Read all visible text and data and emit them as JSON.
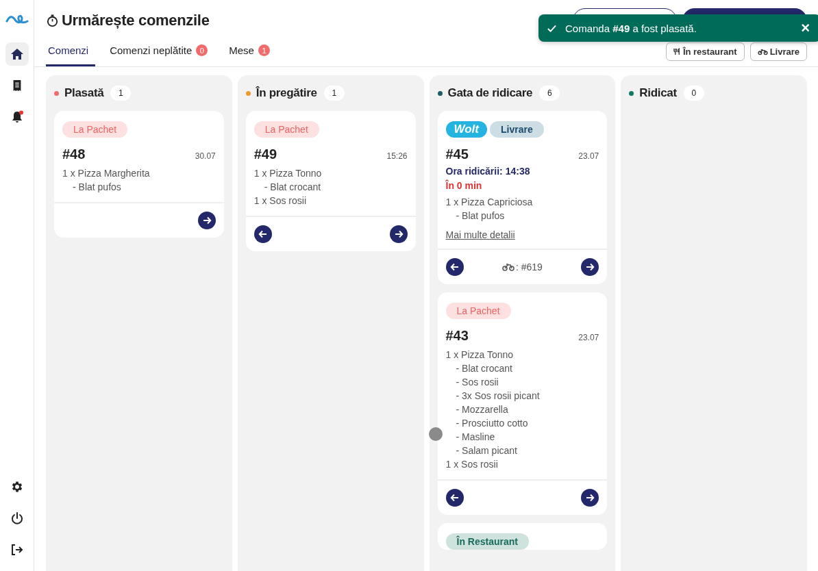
{
  "sidebar": {
    "items": [
      {
        "kind": "home",
        "selected": true
      },
      {
        "kind": "receipt",
        "selected": false
      },
      {
        "kind": "bell",
        "selected": false,
        "badge": true
      }
    ],
    "bottom_items": [
      {
        "kind": "settings"
      },
      {
        "kind": "power"
      },
      {
        "kind": "logout"
      }
    ]
  },
  "header": {
    "title": "Urmărește comenzile"
  },
  "tabs": [
    {
      "label": "Comenzi",
      "selected": true
    },
    {
      "label": "Comenzi neplătite",
      "count": "0",
      "selected": false
    },
    {
      "label": "Mese",
      "count": "1",
      "selected": false
    }
  ],
  "filters": [
    {
      "kind": "restaurant",
      "label": "În restaurant"
    },
    {
      "kind": "delivery",
      "label": "Livrare"
    }
  ],
  "toast": {
    "text": "Comanda **#49** a fost plasată.",
    "close": "×"
  },
  "columns": [
    {
      "title": "Plasată",
      "count": "1",
      "color": "#f26b6b",
      "cards": [
        {
          "tags": [
            {
              "kind": "pachet",
              "label": "La Pachet"
            }
          ],
          "number": "#48",
          "time": "30.07",
          "items": [
            {
              "text": "1 x Pizza Margherita",
              "children": [
                {
                  "text": "- Blat pufos"
                }
              ]
            }
          ],
          "back": false,
          "forward": true
        }
      ]
    },
    {
      "title": "În pregătire",
      "count": "1",
      "color": "#ef9a2d",
      "cards": [
        {
          "tags": [
            {
              "kind": "pachet",
              "label": "La Pachet"
            }
          ],
          "number": "#49",
          "time": "15:26",
          "items": [
            {
              "text": "1 x Pizza Tonno",
              "children": [
                {
                  "text": "- Blat crocant"
                }
              ]
            },
            {
              "text": "1 x Sos rosii"
            }
          ],
          "back": true,
          "forward": true
        }
      ]
    },
    {
      "title": "Gata de ridicare",
      "count": "6",
      "color": "#1b5e66",
      "cards": [
        {
          "tags": [
            {
              "kind": "wolt",
              "label": "Wolt"
            },
            {
              "kind": "livrare",
              "label": "Livrare"
            }
          ],
          "number": "#45",
          "time": "23.07",
          "pickup": "Ora ridicării: 14:38",
          "due": "În 0 min",
          "items": [
            {
              "text": "1 x Pizza Capriciosa",
              "children": [
                {
                  "text": "- Blat pufos"
                }
              ]
            }
          ],
          "link": "Mai multe detalii",
          "courier": ": #619",
          "back": true,
          "forward": true
        },
        {
          "tags": [
            {
              "kind": "pachet",
              "label": "La Pachet"
            }
          ],
          "number": "#43",
          "time": "23.07",
          "items": [
            {
              "text": "1 x Pizza Tonno",
              "children": [
                {
                  "text": "- Blat crocant"
                },
                {
                  "text": "- Sos rosii"
                },
                {
                  "text": "- 3x Sos rosii picant"
                },
                {
                  "text": "- Mozzarella"
                },
                {
                  "text": "- Prosciutto cotto"
                },
                {
                  "text": "- Masline"
                },
                {
                  "text": "- Salam picant"
                }
              ]
            },
            {
              "text": "1 x Sos rosii"
            }
          ],
          "back": true,
          "forward": true
        },
        {
          "tags": [
            {
              "kind": "restaurant",
              "label": "În Restaurant"
            }
          ]
        }
      ]
    },
    {
      "title": "Ridicat",
      "count": "0",
      "color": "#137a64"
    }
  ]
}
